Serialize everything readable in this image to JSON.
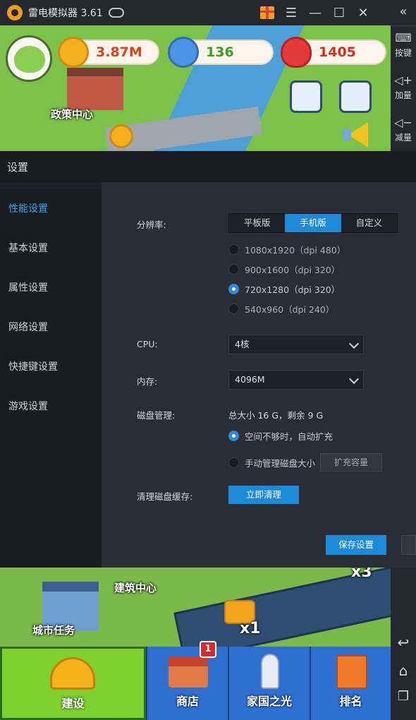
{
  "window": {
    "title": "雷电模拟器 3.61"
  },
  "sidebar_right": {
    "items": [
      {
        "label": "按键",
        "icon": "keyboard-icon"
      },
      {
        "label": "加量",
        "icon": "volume-up-icon"
      },
      {
        "label": "减量",
        "icon": "volume-down-icon"
      }
    ],
    "nav_icons": [
      "back-icon",
      "home-icon",
      "recent-apps-icon"
    ]
  },
  "game_hud": {
    "coins": "3.87M",
    "gems": "136",
    "hearts": "1405",
    "building_label": "政策中心"
  },
  "settings": {
    "title": "设置",
    "menu": [
      {
        "label": "性能设置",
        "active": true
      },
      {
        "label": "基本设置",
        "active": false
      },
      {
        "label": "属性设置",
        "active": false
      },
      {
        "label": "网络设置",
        "active": false
      },
      {
        "label": "快捷键设置",
        "active": false
      },
      {
        "label": "游戏设置",
        "active": false
      }
    ],
    "resolution": {
      "label": "分辨率:",
      "modes": [
        "平板版",
        "手机版",
        "自定义"
      ],
      "selected_mode": "手机版",
      "options": [
        "1080x1920（dpi 480）",
        "900x1600（dpi 320）",
        "720x1280（dpi 320）",
        "540x960（dpi 240）"
      ],
      "selected_option": "720x1280（dpi 320）"
    },
    "cpu": {
      "label": "CPU:",
      "value": "4核"
    },
    "memory": {
      "label": "内存:",
      "value": "4096M"
    },
    "disk": {
      "label": "磁盘管理:",
      "info": "总大小 16 G，剩余 9 G",
      "auto_option": "空间不够时，自动扩充",
      "manual_option": "手动管理磁盘大小",
      "expand_button": "扩充容量"
    },
    "cache": {
      "label": "清理磁盘缓存:",
      "clean_button": "立即清理"
    },
    "save_button": "保存设置"
  },
  "game_bottom": {
    "labels": [
      "建筑中心",
      "城市任务"
    ],
    "multipliers": [
      "x1",
      "x3"
    ]
  },
  "bottom_nav": {
    "tabs": [
      {
        "label": "建设",
        "active": true
      },
      {
        "label": "商店",
        "badge": "1"
      },
      {
        "label": "家国之光"
      },
      {
        "label": "排名"
      }
    ]
  },
  "colors": {
    "accent": "#1c8ad6",
    "active_menu_text": "#3ba3f0",
    "panel_bg": "#2a2c36"
  }
}
